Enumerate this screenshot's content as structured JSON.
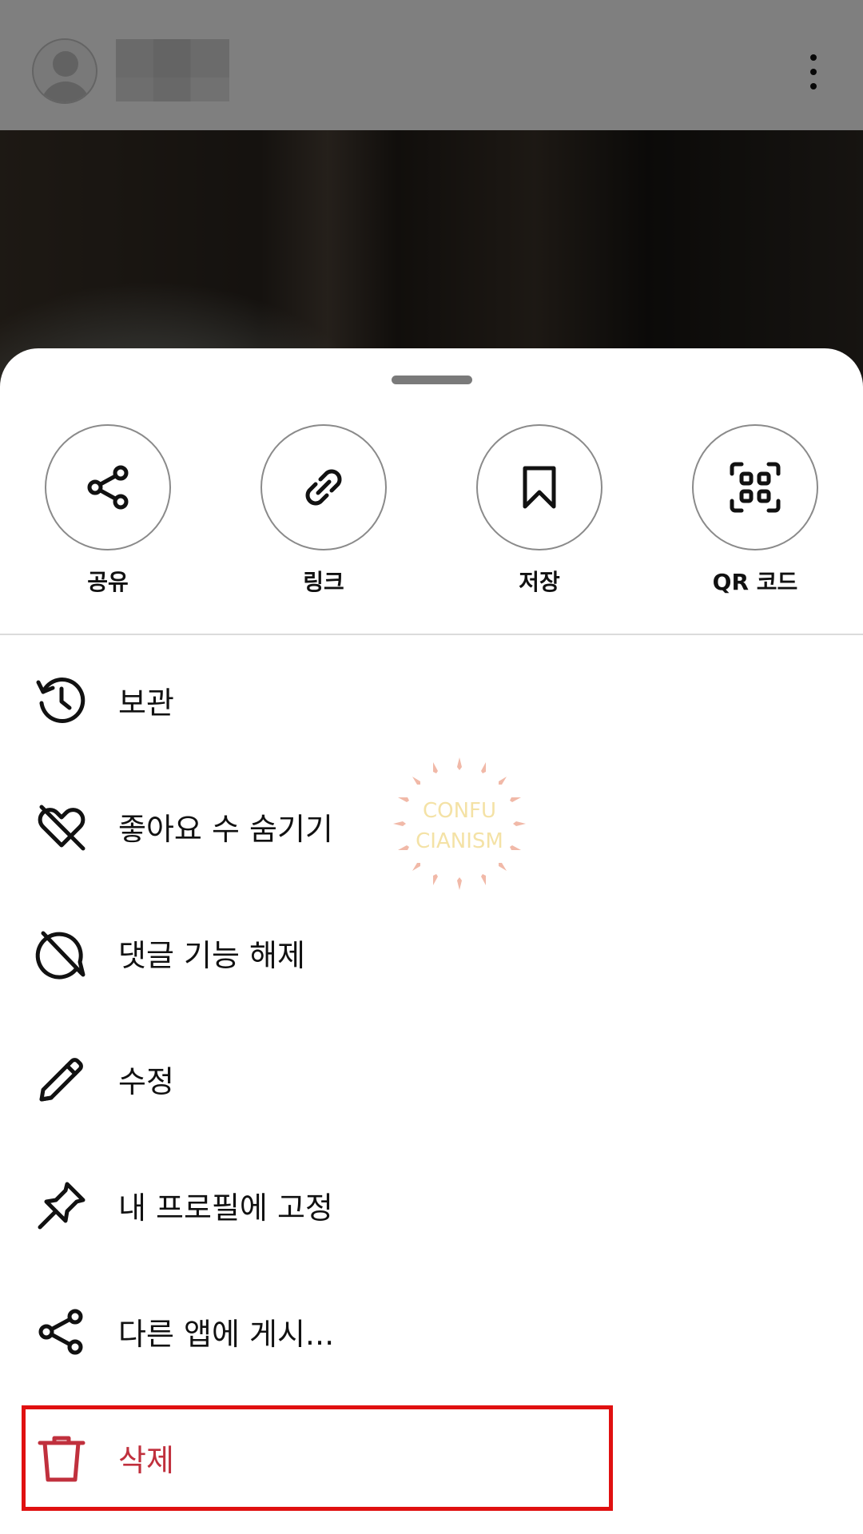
{
  "post": {
    "avatar_icon": "default-avatar-icon",
    "more_icon": "more-vertical-icon"
  },
  "quick_actions": [
    {
      "label": "공유",
      "icon": "share-icon"
    },
    {
      "label": "링크",
      "icon": "link-icon"
    },
    {
      "label": "저장",
      "icon": "bookmark-icon"
    },
    {
      "label": "QR 코드",
      "icon": "qr-code-icon"
    }
  ],
  "menu": [
    {
      "label": "보관",
      "icon": "archive-history-icon"
    },
    {
      "label": "좋아요 수 숨기기",
      "icon": "heart-off-icon"
    },
    {
      "label": "댓글 기능 해제",
      "icon": "comment-off-icon"
    },
    {
      "label": "수정",
      "icon": "pencil-icon"
    },
    {
      "label": "내 프로필에 고정",
      "icon": "pin-icon"
    },
    {
      "label": "다른 앱에 게시...",
      "icon": "share-icon"
    },
    {
      "label": "삭제",
      "icon": "trash-icon",
      "color": "#c0303d"
    }
  ],
  "watermark": {
    "line1": "CONFU",
    "line2": "CIANISM"
  },
  "colors": {
    "danger": "#c0303d",
    "highlight": "#e01010"
  }
}
